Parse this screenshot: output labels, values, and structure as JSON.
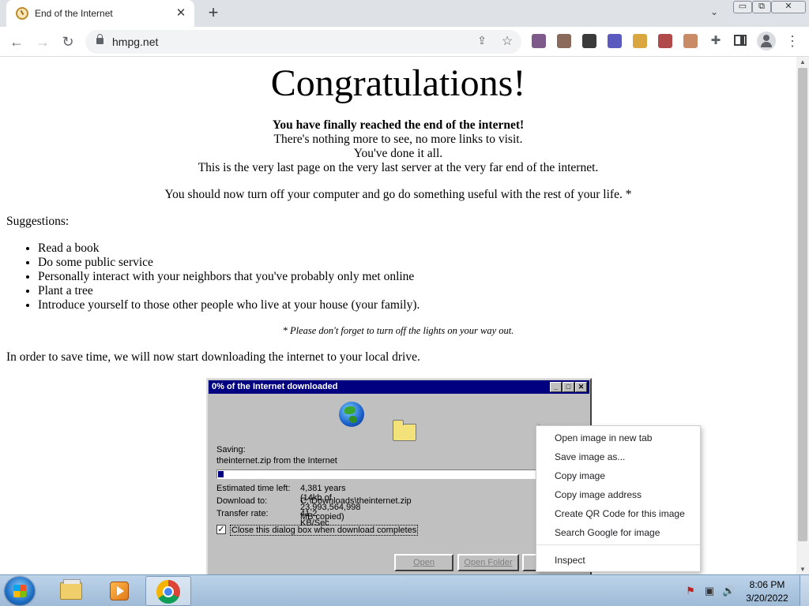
{
  "browser": {
    "tab_title": "End of the Internet",
    "tab_close": "✕",
    "new_tab": "+",
    "tab_search": "⌄",
    "url": "hmpg.net",
    "window_controls": {
      "minimize": "▭",
      "maximize": "⧉",
      "close": "✕"
    },
    "nav": {
      "back": "←",
      "forward": "→",
      "reload": "↻"
    },
    "icons": {
      "share": "⇪",
      "star": "☆",
      "extensions": "✚",
      "menu": "⋮"
    },
    "extension_colors": [
      "#7e5a8a",
      "#8a6a5a",
      "#3a3a3a",
      "#5b5bbf",
      "#d9a640",
      "#b04a4a",
      "#c98a66"
    ]
  },
  "page": {
    "heading": "Congratulations!",
    "lead_bold": "You have finally reached the end of the internet!",
    "lines": [
      "There's nothing more to see, no more links to visit.",
      "You've done it all.",
      "This is the very last page on the very last server at the very far end of the internet."
    ],
    "turn_off": "You should now turn off your computer and go do something useful with the rest of your life. *",
    "suggestions_label": "Suggestions:",
    "suggestions": [
      "Read a book",
      "Do some public service",
      "Personally interact with your neighbors that you've probably only met online",
      "Plant a tree",
      "Introduce yourself to those other people who live at your house (your family)."
    ],
    "footnote": "* Please don't forget to turn off the lights on your way out.",
    "download_line": "In order to save time, we will now start downloading the internet to your local drive."
  },
  "dialog": {
    "title": "0% of the Internet downloaded",
    "title_buttons": [
      "_",
      "□",
      "✕"
    ],
    "saving_label": "Saving:",
    "saving_file": "theinternet.zip from the Internet",
    "progress_fraction": 0.015,
    "fields": [
      {
        "label": "Estimated time left:",
        "value": "4,381 years (14kb of 23,993,564,998 MB copied)"
      },
      {
        "label": "Download to:",
        "value": "C:\\Downloads\\theinternet.zip"
      },
      {
        "label": "Transfer rate:",
        "value": "41.2 KB/Sec"
      }
    ],
    "checkbox_mark": "✓",
    "checkbox_label": "Close this dialog box when download completes",
    "btn_open": "Open",
    "btn_open_folder": "Open Folder"
  },
  "context_menu": {
    "items": [
      "Open image in new tab",
      "Save image as...",
      "Copy image",
      "Copy image address",
      "Create QR Code for this image",
      "Search Google for image"
    ],
    "inspect": "Inspect"
  },
  "taskbar": {
    "clock_time": "8:06 PM",
    "clock_date": "3/20/2022",
    "tray": {
      "flag": "⚑",
      "network": "▣",
      "volume": "🔊"
    }
  }
}
